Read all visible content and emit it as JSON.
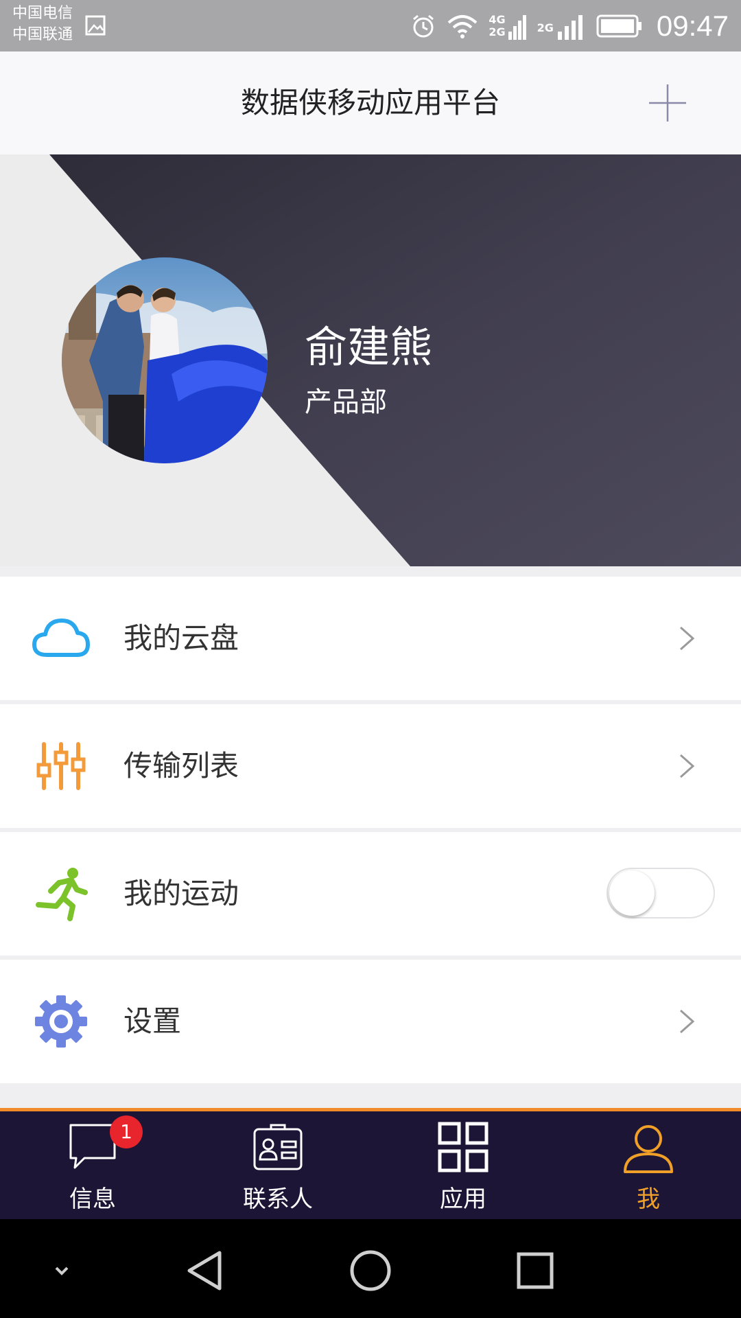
{
  "status_bar": {
    "carrier_1": "中国电信",
    "carrier_2": "中国联通",
    "net_4g": "4G",
    "net_2g_a": "2G",
    "net_2g_b": "2G",
    "time": "09:47"
  },
  "header": {
    "title": "数据侠移动应用平台",
    "add_icon": "plus-icon"
  },
  "profile": {
    "name": "俞建熊",
    "department": "产品部"
  },
  "menu": {
    "items": [
      {
        "label": "我的云盘",
        "icon": "cloud-icon",
        "color": "#2aa8ee"
      },
      {
        "label": "传输列表",
        "icon": "sliders-icon",
        "color": "#f39a3a"
      },
      {
        "label": "我的运动",
        "icon": "running-icon",
        "color": "#7cc22a",
        "toggle": "off"
      },
      {
        "label": "设置",
        "icon": "gear-icon",
        "color": "#6d85e0"
      }
    ]
  },
  "bottom_nav": {
    "tabs": [
      {
        "label": "信息",
        "icon": "chat-icon",
        "badge": "1"
      },
      {
        "label": "联系人",
        "icon": "contact-card-icon"
      },
      {
        "label": "应用",
        "icon": "grid-icon"
      },
      {
        "label": "我",
        "icon": "person-icon",
        "active": true
      }
    ],
    "accent": "#f0a028"
  },
  "system_nav": [
    "collapse-icon",
    "back-icon",
    "home-icon",
    "recents-icon"
  ]
}
